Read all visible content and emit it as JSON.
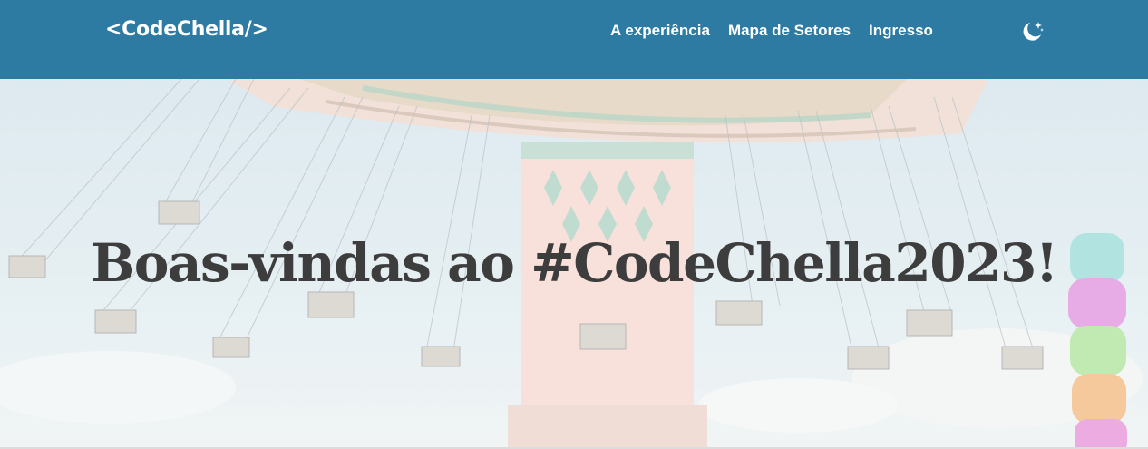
{
  "header": {
    "logo_text": "<CodeChella/>",
    "nav": [
      {
        "label": "A experiência"
      },
      {
        "label": "Mapa de Setores"
      },
      {
        "label": "Ingresso"
      }
    ],
    "theme_toggle_icon": "moon-stars-icon"
  },
  "hero": {
    "title": "Boas-vindas ao #CodeChella2023!",
    "background_image": "swing-carousel-photo"
  },
  "colors": {
    "header_bg": "#2d7aa3",
    "header_text": "#ffffff",
    "title_text": "#3d3d3d"
  }
}
